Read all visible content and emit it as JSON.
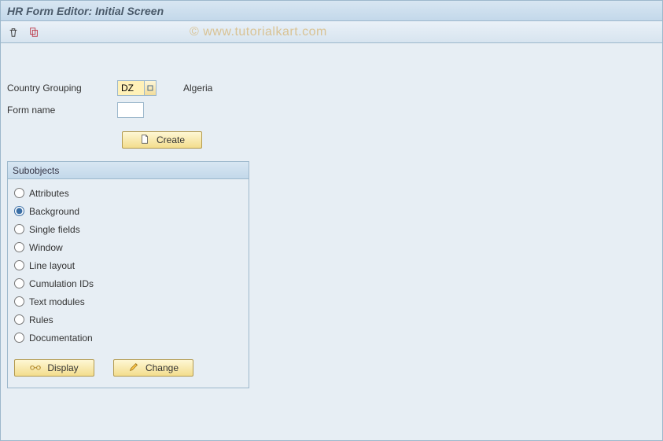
{
  "title": "HR Form Editor: Initial Screen",
  "watermark": "© www.tutorialkart.com",
  "fields": {
    "country_label": "Country Grouping",
    "country_code": "DZ",
    "country_desc": "Algeria",
    "formname_label": "Form name",
    "formname_value": ""
  },
  "buttons": {
    "create": "Create",
    "display": "Display",
    "change": "Change"
  },
  "subobjects": {
    "header": "Subobjects",
    "items": [
      {
        "label": "Attributes",
        "selected": false
      },
      {
        "label": "Background",
        "selected": true
      },
      {
        "label": "Single fields",
        "selected": false
      },
      {
        "label": "Window",
        "selected": false
      },
      {
        "label": "Line layout",
        "selected": false
      },
      {
        "label": "Cumulation IDs",
        "selected": false
      },
      {
        "label": "Text modules",
        "selected": false
      },
      {
        "label": "Rules",
        "selected": false
      },
      {
        "label": "Documentation",
        "selected": false
      }
    ]
  }
}
